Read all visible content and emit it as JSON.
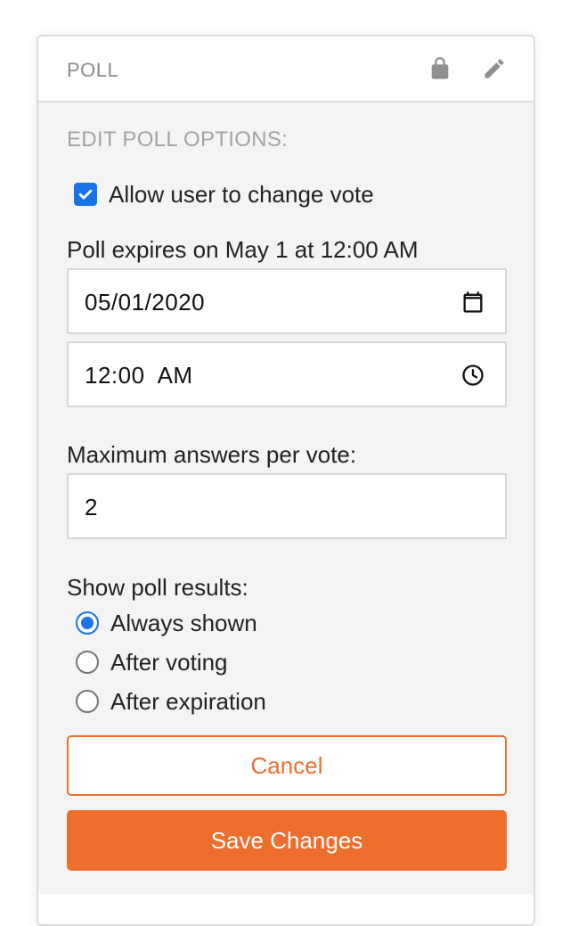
{
  "header": {
    "title": "POLL",
    "icons": [
      "lock-icon",
      "pencil-icon"
    ]
  },
  "section": {
    "title": "EDIT POLL OPTIONS:"
  },
  "allow_change": {
    "label": "Allow user to change vote",
    "checked": true
  },
  "expires": {
    "label": "Poll expires on May 1 at 12:00 AM",
    "date_value": "05/01/2020",
    "date_icon": "calendar-icon",
    "time_value": "12:00  AM",
    "time_icon": "clock-icon"
  },
  "max_answers": {
    "label": "Maximum answers per vote:",
    "value": "2"
  },
  "results": {
    "label": "Show poll results:",
    "options": [
      {
        "label": "Always shown",
        "selected": true
      },
      {
        "label": "After voting",
        "selected": false
      },
      {
        "label": "After expiration",
        "selected": false
      }
    ]
  },
  "buttons": {
    "cancel": "Cancel",
    "save": "Save Changes"
  },
  "colors": {
    "accent": "#ee6e2e",
    "checkbox_blue": "#1a73e8",
    "panel_bg": "#f4f4f4",
    "muted_text": "#8a8a8a"
  }
}
